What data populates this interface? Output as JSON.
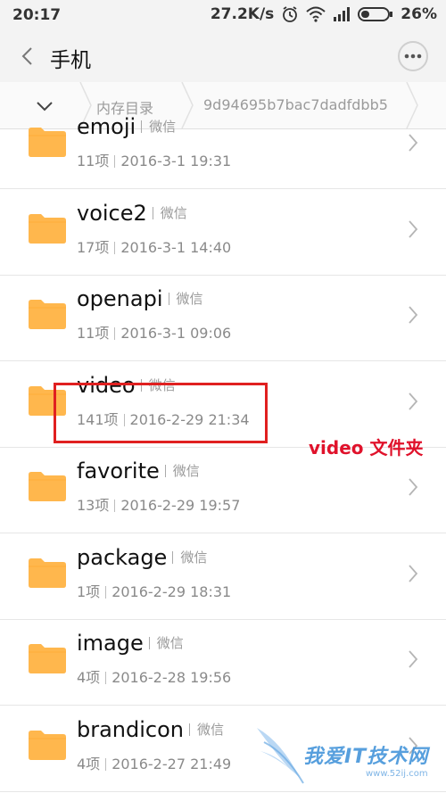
{
  "status_bar": {
    "time": "20:17",
    "network_speed": "27.2K/s",
    "battery": "26%",
    "icons": [
      "alarm-icon",
      "wifi-icon",
      "signal-icon",
      "battery-icon"
    ]
  },
  "app_bar": {
    "title": "手机",
    "back_icon": "chevron-left-icon",
    "more_icon": "more-horizontal-icon"
  },
  "breadcrumb": {
    "items": [
      "内存目录",
      "9d94695b7bac7dadfdbb5"
    ]
  },
  "files": [
    {
      "name": "emoji",
      "source": "微信",
      "count": "11项",
      "date": "2016-3-1 19:31"
    },
    {
      "name": "voice2",
      "source": "微信",
      "count": "17项",
      "date": "2016-3-1 14:40"
    },
    {
      "name": "openapi",
      "source": "微信",
      "count": "11项",
      "date": "2016-3-1 09:06"
    },
    {
      "name": "video",
      "source": "微信",
      "count": "141项",
      "date": "2016-2-29 21:34"
    },
    {
      "name": "favorite",
      "source": "微信",
      "count": "13项",
      "date": "2016-2-29 19:57"
    },
    {
      "name": "package",
      "source": "微信",
      "count": "1项",
      "date": "2016-2-29 18:31"
    },
    {
      "name": "image",
      "source": "微信",
      "count": "4项",
      "date": "2016-2-28 19:56"
    },
    {
      "name": "brandicon",
      "source": "微信",
      "count": "4项",
      "date": "2016-2-27 21:49"
    }
  ],
  "annotation": {
    "label": "video 文件夹"
  },
  "watermark": {
    "text": "我爱IT技术网",
    "url": "www.52ij.com"
  },
  "colors": {
    "folder": "#FFB74D",
    "highlight": "#E02020",
    "annotation": "#E0122B"
  }
}
